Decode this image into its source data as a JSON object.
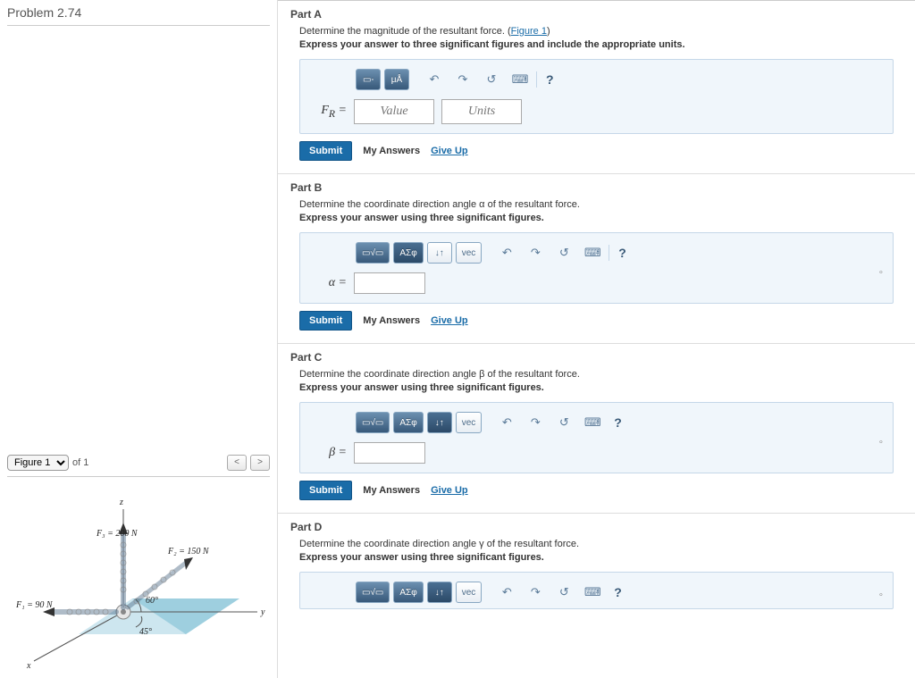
{
  "problem_title": "Problem 2.74",
  "figure_selector": {
    "label": "Figure 1",
    "of": "of 1"
  },
  "figure": {
    "z": "z",
    "x": "x",
    "y": "y",
    "f1": "F₁ = 90 N",
    "f2": "F₂ = 150 N",
    "f3": "F₃ = 200 N",
    "a60": "60°",
    "a45": "45°"
  },
  "parts": {
    "A": {
      "title": "Part A",
      "prompt1_a": "Determine the magnitude of the resultant force. (",
      "prompt1_link": "Figure 1",
      "prompt1_b": ")",
      "prompt2": "Express your answer to three significant figures and include the appropriate units.",
      "lhs": "F_R =",
      "value_ph": "Value",
      "units_ph": "Units",
      "tb": {
        "mu": "μÅ"
      }
    },
    "B": {
      "title": "Part B",
      "prompt1": "Determine the coordinate direction angle α of the resultant force.",
      "prompt2": "Express your answer using three significant figures.",
      "lhs": "α =",
      "tb": {
        "greek": "ΑΣφ",
        "vec": "vec",
        "arrows": "↓↑"
      }
    },
    "C": {
      "title": "Part C",
      "prompt1": "Determine the coordinate direction angle β of the resultant force.",
      "prompt2": "Express your answer using three significant figures.",
      "lhs": "β =",
      "tb": {
        "greek": "ΑΣφ",
        "vec": "vec",
        "arrows": "↓↑"
      }
    },
    "D": {
      "title": "Part D",
      "prompt1": "Determine the coordinate direction angle γ of the resultant force.",
      "prompt2": "Express your answer using three significant figures.",
      "tb": {
        "greek": "ΑΣφ",
        "vec": "vec",
        "arrows": "↓↑"
      }
    }
  },
  "common": {
    "submit": "Submit",
    "my_answers": "My Answers",
    "give_up": "Give Up",
    "help": "?"
  }
}
